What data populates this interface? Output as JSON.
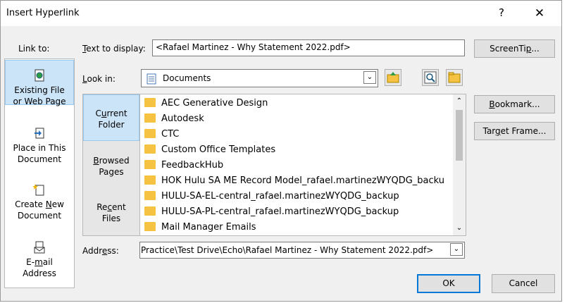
{
  "window": {
    "title": "Insert Hyperlink",
    "help_label": "?",
    "close_label": "✕"
  },
  "link_to": {
    "label": "Link to:",
    "items": [
      {
        "label_line1": "Existing File",
        "label_line2": "or Web Page",
        "icon": "existing-file-icon",
        "selected": true
      },
      {
        "label_line1": "Place in This",
        "label_line2": "Document",
        "icon": "place-in-document-icon",
        "selected": false
      },
      {
        "label_line1": "Create New",
        "label_line2": "Document",
        "icon": "create-new-document-icon",
        "selected": false
      },
      {
        "label_line1": "E-mail",
        "label_line2": "Address",
        "icon": "email-address-icon",
        "selected": false
      }
    ]
  },
  "text_to_display": {
    "label": "Text to display:",
    "value": "<Rafael Martinez - Why Statement 2022.pdf>"
  },
  "screentip_button": "ScreenTip...",
  "look_in": {
    "label": "Look in:",
    "value": "Documents"
  },
  "subnav": {
    "items": [
      {
        "line1": "Current",
        "line2": "Folder",
        "selected": true
      },
      {
        "line1": "Browsed",
        "line2": "Pages",
        "selected": false
      },
      {
        "line1": "Recent",
        "line2": "Files",
        "selected": false
      }
    ]
  },
  "files": [
    "AEC Generative Design",
    "Autodesk",
    "CTC",
    "Custom Office Templates",
    "FeedbackHub",
    "HOK Hulu SA ME Record Model_rafael.martinezWYQDG_backu",
    "HULU-SA-EL-central_rafael.martinezWYQDG_backup",
    "HULU-SA-PL-central_rafael.martinezWYQDG_backup",
    "Mail Manager Emails"
  ],
  "side_buttons": {
    "bookmark": "Bookmark...",
    "target_frame": "Target Frame..."
  },
  "address": {
    "label": "Address:",
    "value": "Practice\\Test Drive\\Echo\\Rafael Martinez - Why Statement 2022.pdf>"
  },
  "ok_button": "OK",
  "cancel_button": "Cancel",
  "colors": {
    "accent": "#0078d7",
    "selected_bg": "#cce4f7",
    "folder": "#f5c242"
  }
}
